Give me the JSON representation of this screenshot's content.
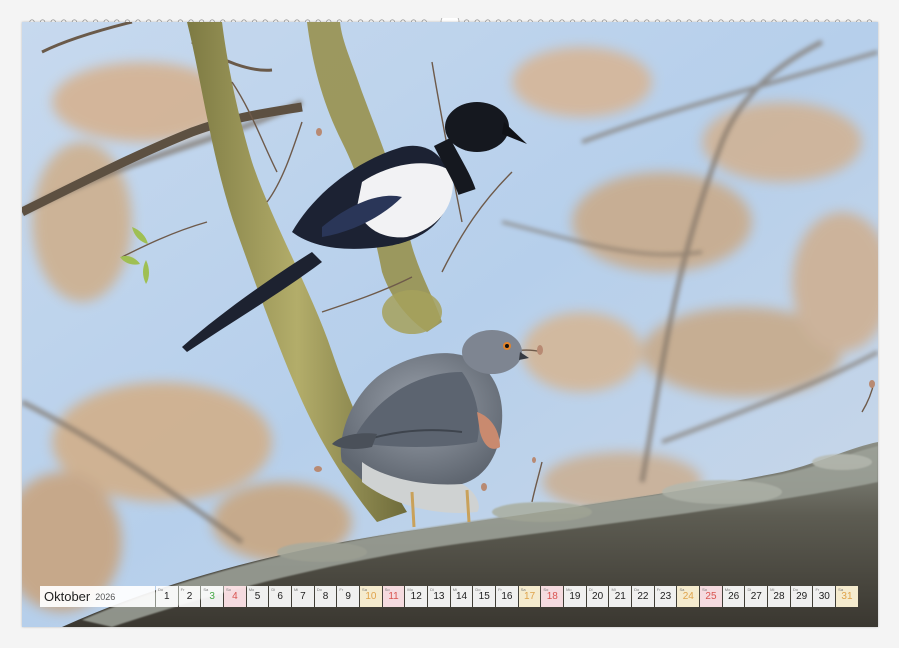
{
  "calendar": {
    "month": "Oktober",
    "year": "2026",
    "days": [
      {
        "abbr": "Do",
        "num": "1",
        "kind": "weekday"
      },
      {
        "abbr": "Fr",
        "num": "2",
        "kind": "weekday"
      },
      {
        "abbr": "Sa",
        "num": "3",
        "kind": "holiday"
      },
      {
        "abbr": "So",
        "num": "4",
        "kind": "sunday"
      },
      {
        "abbr": "Mo",
        "num": "5",
        "kind": "weekday"
      },
      {
        "abbr": "Di",
        "num": "6",
        "kind": "weekday"
      },
      {
        "abbr": "Mi",
        "num": "7",
        "kind": "weekday"
      },
      {
        "abbr": "Do",
        "num": "8",
        "kind": "weekday"
      },
      {
        "abbr": "Fr",
        "num": "9",
        "kind": "weekday"
      },
      {
        "abbr": "Sa",
        "num": "10",
        "kind": "saturday"
      },
      {
        "abbr": "So",
        "num": "11",
        "kind": "sunday"
      },
      {
        "abbr": "Mo",
        "num": "12",
        "kind": "weekday"
      },
      {
        "abbr": "Di",
        "num": "13",
        "kind": "weekday"
      },
      {
        "abbr": "Mi",
        "num": "14",
        "kind": "weekday"
      },
      {
        "abbr": "Do",
        "num": "15",
        "kind": "weekday"
      },
      {
        "abbr": "Fr",
        "num": "16",
        "kind": "weekday"
      },
      {
        "abbr": "Sa",
        "num": "17",
        "kind": "saturday"
      },
      {
        "abbr": "So",
        "num": "18",
        "kind": "sunday"
      },
      {
        "abbr": "Mo",
        "num": "19",
        "kind": "weekday"
      },
      {
        "abbr": "Di",
        "num": "20",
        "kind": "weekday"
      },
      {
        "abbr": "Mi",
        "num": "21",
        "kind": "weekday"
      },
      {
        "abbr": "Do",
        "num": "22",
        "kind": "weekday"
      },
      {
        "abbr": "Fr",
        "num": "23",
        "kind": "weekday"
      },
      {
        "abbr": "Sa",
        "num": "24",
        "kind": "saturday"
      },
      {
        "abbr": "So",
        "num": "25",
        "kind": "sunday"
      },
      {
        "abbr": "Mo",
        "num": "26",
        "kind": "weekday"
      },
      {
        "abbr": "Di",
        "num": "27",
        "kind": "weekday"
      },
      {
        "abbr": "Mi",
        "num": "28",
        "kind": "weekday"
      },
      {
        "abbr": "Do",
        "num": "29",
        "kind": "weekday"
      },
      {
        "abbr": "Fr",
        "num": "30",
        "kind": "weekday"
      },
      {
        "abbr": "Sa",
        "num": "31",
        "kind": "saturday"
      }
    ]
  },
  "colors": {
    "sky": "#b9d2ec",
    "saturday_text": "#e0a34a",
    "sunday_text": "#d9534f",
    "holiday_text": "#45a845"
  }
}
